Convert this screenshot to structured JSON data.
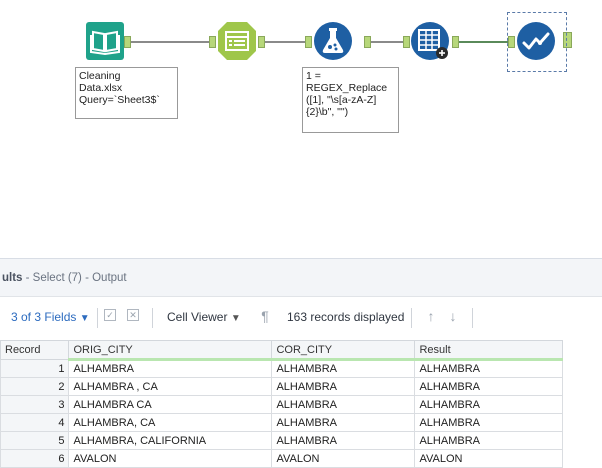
{
  "workflow": {
    "tools": [
      {
        "name": "input-data-tool",
        "icon": "book-icon",
        "color": "#1fa28a"
      },
      {
        "name": "select-tool",
        "icon": "select-list-icon",
        "color": "#9fc64a"
      },
      {
        "name": "formula-tool",
        "icon": "flask-icon",
        "color": "#1e5fa3"
      },
      {
        "name": "data-cleansing-tool",
        "icon": "table-plus-icon",
        "color": "#1e5fa3"
      },
      {
        "name": "browse-tool",
        "icon": "check-wave-icon",
        "color": "#1e5fa3"
      }
    ],
    "input_annotation": "Cleaning\nData.xlsx\nQuery=`Sheet3$`",
    "formula_annotation": "1 =\nREGEX_Replace\n([1], \"\\s[a-zA-Z]\n{2}\\b\", \"\")"
  },
  "results": {
    "title_prefix": "ults",
    "title_rest": " - Select (7) - Output",
    "fields_label": "3 of 3 Fields",
    "cell_viewer_label": "Cell Viewer",
    "records_label": "163 records displayed",
    "columns": [
      "Record",
      "ORIG_CITY",
      "COR_CITY",
      "Result"
    ],
    "rows": [
      [
        "1",
        "ALHAMBRA",
        "ALHAMBRA",
        "ALHAMBRA"
      ],
      [
        "2",
        "ALHAMBRA , CA",
        "ALHAMBRA",
        "ALHAMBRA"
      ],
      [
        "3",
        "ALHAMBRA CA",
        "ALHAMBRA",
        "ALHAMBRA"
      ],
      [
        "4",
        "ALHAMBRA, CA",
        "ALHAMBRA",
        "ALHAMBRA"
      ],
      [
        "5",
        "ALHAMBRA, CALIFORNIA",
        "ALHAMBRA",
        "ALHAMBRA"
      ],
      [
        "6",
        "AVALON",
        "AVALON",
        "AVALON"
      ]
    ]
  }
}
